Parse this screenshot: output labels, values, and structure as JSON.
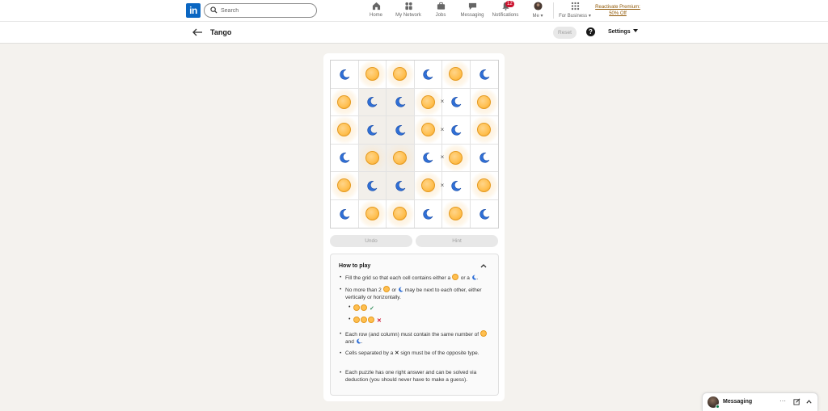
{
  "nav": {
    "logo": "in",
    "search_placeholder": "Search",
    "items": [
      {
        "label": "Home",
        "icon": "home-icon"
      },
      {
        "label": "My Network",
        "icon": "network-icon"
      },
      {
        "label": "Jobs",
        "icon": "briefcase-icon"
      },
      {
        "label": "Messaging",
        "icon": "messaging-icon"
      },
      {
        "label": "Notifications",
        "icon": "bell-icon",
        "badge": "12"
      },
      {
        "label": "Me",
        "icon": "avatar-icon"
      },
      {
        "label": "For Business",
        "icon": "grid-icon"
      }
    ],
    "premium_line1": "Reactivate Premium:",
    "premium_line2": "50% Off"
  },
  "header": {
    "title": "Tango",
    "reset_label": "Reset",
    "help_label": "?",
    "settings_label": "Settings"
  },
  "puzzle": {
    "grid": [
      [
        "moon",
        "sun",
        "sun",
        "moon",
        "sun",
        "moon"
      ],
      [
        "sun",
        "moon",
        "moon",
        "sun",
        "moon",
        "sun"
      ],
      [
        "sun",
        "moon",
        "moon",
        "sun",
        "moon",
        "sun"
      ],
      [
        "moon",
        "sun",
        "sun",
        "moon",
        "sun",
        "moon"
      ],
      [
        "sun",
        "moon",
        "moon",
        "sun",
        "moon",
        "sun"
      ],
      [
        "moon",
        "sun",
        "sun",
        "moon",
        "sun",
        "moon"
      ]
    ],
    "shaded": [
      [
        1,
        1
      ],
      [
        1,
        2
      ],
      [
        2,
        1
      ],
      [
        2,
        2
      ],
      [
        3,
        1
      ],
      [
        3,
        2
      ],
      [
        4,
        1
      ],
      [
        4,
        2
      ]
    ],
    "x_signs": [
      [
        1,
        4
      ],
      [
        2,
        4
      ],
      [
        3,
        4
      ],
      [
        4,
        4
      ]
    ],
    "x_symbol": "×",
    "undo_label": "Undo",
    "hint_label": "Hint"
  },
  "howto": {
    "title": "How to play",
    "rule1_a": "Fill the grid so that each cell contains either a",
    "rule1_b": "or a",
    "rule1_c": ".",
    "rule2_a": "No more than 2",
    "rule2_b": "or",
    "rule2_c": "may be next to each other, either vertically or horizontally.",
    "example_ok": "✓",
    "example_bad": "✕",
    "rule3_a": "Each row (and column) must contain the same number of",
    "rule3_b": "and",
    "rule3_c": ".",
    "rule4_a": "Cells separated by a",
    "rule4_sym": "✕",
    "rule4_b": "sign must be of the opposite type.",
    "rule5": "Each puzzle has one right answer and can be solved via deduction (you should never have to make a guess)."
  },
  "messaging": {
    "label": "Messaging",
    "more": "···"
  },
  "colors": {
    "brand": "#0a66c2",
    "sun": "#ffbf4f",
    "moon": "#2f6fd6",
    "premium": "#915907"
  }
}
